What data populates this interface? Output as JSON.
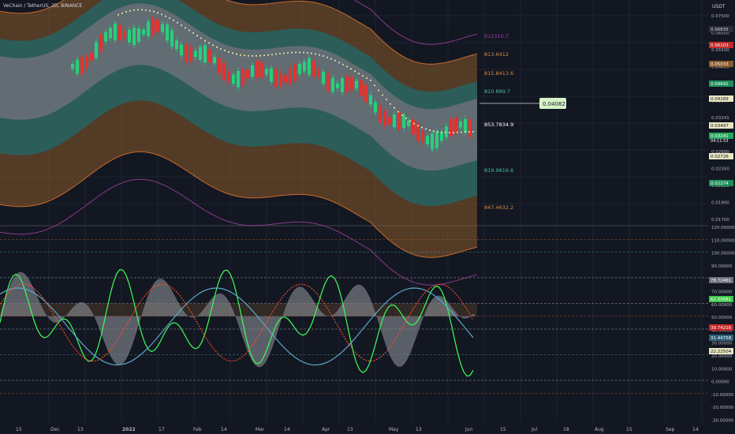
{
  "symbol_title": "VeChain / TetherUS, 2D, BINANCE",
  "currency": "USDT",
  "colors": {
    "background": "#131722",
    "grid": "#1f2330",
    "candle_up": "#26d07c",
    "candle_down": "#e5312d",
    "band_orange": "#8a5a2a",
    "band_teal": "#1f6a6a",
    "band_grey": "#6b6f78",
    "pivot_yellow": "#f5f0a8",
    "osc_green": "#3cff5a",
    "osc_blue": "#5aa8c8",
    "osc_red": "#ff4d2a",
    "osc_tan": "#c98a5a"
  },
  "price_axis": {
    "ticks": [
      "0.07500",
      "0.06500",
      "0.05500",
      "0.04400",
      "0.04000",
      "0.03600",
      "0.03241",
      "0.02900",
      "0.02600",
      "0.02350",
      "0.02100",
      "0.01900",
      "0.01700"
    ],
    "badges": [
      {
        "text": "0.06835",
        "bg": "#2a2e39",
        "fg": "#d1d4dc"
      },
      {
        "text": "0.06103",
        "bg": "#c62828",
        "fg": "#ffffff"
      },
      {
        "text": "0.05033",
        "bg": "#8a5a2a",
        "fg": "#ffffff"
      },
      {
        "text": "0.04641",
        "bg": "#1c8f5a",
        "fg": "#ffffff"
      },
      {
        "text": "0.04189",
        "bg": "#e8e6c0",
        "fg": "#131722"
      },
      {
        "text": "0.03497",
        "bg": "#e8e6c0",
        "fg": "#131722"
      },
      {
        "text": "0.03241",
        "bg": "#26a65b",
        "fg": "#ffffff"
      },
      {
        "text": "0.02726",
        "bg": "#e8e6c0",
        "fg": "#131722"
      },
      {
        "text": "0.02274",
        "bg": "#1c8f5a",
        "fg": "#ffffff"
      }
    ],
    "current_sub": "04:11:53"
  },
  "level_labels": [
    "812310.7",
    "813.6412",
    "815.8413.6",
    "810.889.7",
    "853.7834.9",
    "819.9816.6",
    "847.4632.2"
  ],
  "callout": "0.04082",
  "osc_axis": {
    "ticks": [
      "120.00000",
      "110.00000",
      "100.00000",
      "90.00000",
      "80.00000",
      "70.00000",
      "60.00000",
      "50.00000",
      "40.00000",
      "30.00000",
      "20.00000",
      "10.00000",
      "0.00000",
      "-10.00000",
      "-20.00000",
      "-30.00000"
    ],
    "badges": [
      {
        "text": "78.72461",
        "bg": "#6b6f78",
        "fg": "#ffffff"
      },
      {
        "text": "62.50681",
        "bg": "#3cc84a",
        "fg": "#ffffff"
      },
      {
        "text": "39.74216",
        "bg": "#c62828",
        "fg": "#ffffff"
      },
      {
        "text": "31.44758",
        "bg": "#2a5f7a",
        "fg": "#ffffff"
      },
      {
        "text": "22.22504",
        "bg": "#e8e6c0",
        "fg": "#131722"
      }
    ]
  },
  "time_axis": [
    "15",
    "Dec",
    "13",
    "2022",
    "17",
    "Feb",
    "14",
    "Mar",
    "14",
    "Apr",
    "13",
    "May",
    "13",
    "Jun",
    "15",
    "Jul",
    "18",
    "Aug",
    "15",
    "Sep",
    "14"
  ]
}
